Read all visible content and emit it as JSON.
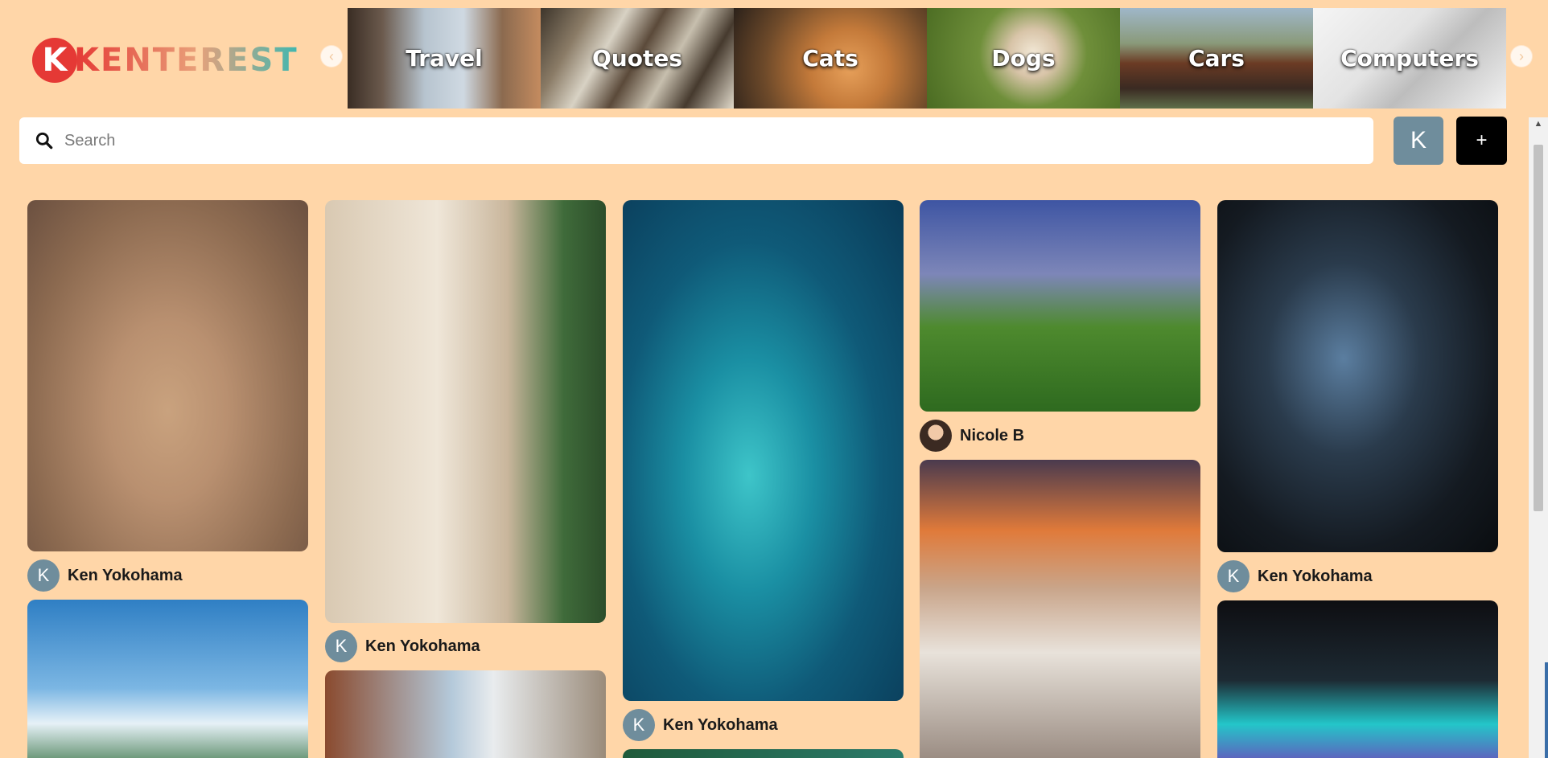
{
  "app": {
    "logo_letter": "K",
    "logo_text": "KENTEREST"
  },
  "carousel": {
    "prev_icon": "chevron-left-icon",
    "next_icon": "chevron-right-icon",
    "categories": [
      {
        "label": "Travel"
      },
      {
        "label": "Quotes"
      },
      {
        "label": "Cats"
      },
      {
        "label": "Dogs"
      },
      {
        "label": "Cars"
      },
      {
        "label": "Computers"
      }
    ]
  },
  "search": {
    "placeholder": "Search",
    "value": "",
    "icon": "search-icon"
  },
  "toolbar": {
    "profile_initial": "K",
    "add_label": "+"
  },
  "pins": [
    {
      "image": "pyramids",
      "author": "Ken Yokohama",
      "author_initial": "K"
    },
    {
      "image": "tropical-island"
    },
    {
      "image": "mediterranean-street",
      "author": "Ken Yokohama",
      "author_initial": "K"
    },
    {
      "image": "narrow-street"
    },
    {
      "image": "ocean-cove",
      "author": "Ken Yokohama",
      "author_initial": "K"
    },
    {
      "image": "coast"
    },
    {
      "image": "park-walk",
      "author": "Nicole B",
      "author_initial": ""
    },
    {
      "image": "santorini-sunset"
    },
    {
      "image": "gaming-desk",
      "author": "Ken Yokohama",
      "author_initial": "K"
    },
    {
      "image": "rgb-pc-case"
    }
  ],
  "colors": {
    "background": "#ffd6a8",
    "avatar": "#6f8d9c",
    "add_button": "#000000"
  }
}
